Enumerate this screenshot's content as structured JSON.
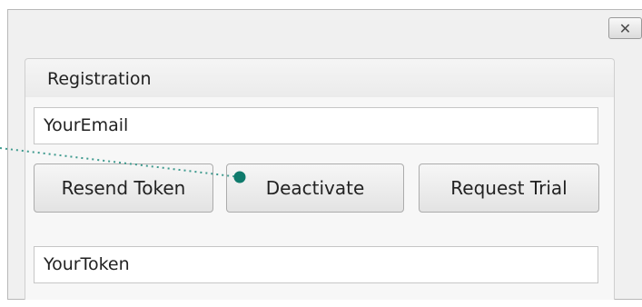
{
  "dialog": {
    "close_label": "✕"
  },
  "registration": {
    "title": "Registration",
    "email_value": "YourEmail",
    "token_value": "YourToken",
    "buttons": {
      "resend": "Resend Token",
      "deactivate": "Deactivate",
      "request_trial": "Request Trial"
    }
  },
  "cursor_marker": {
    "color": "#0f7a6c",
    "icon": "click-marker-icon"
  }
}
